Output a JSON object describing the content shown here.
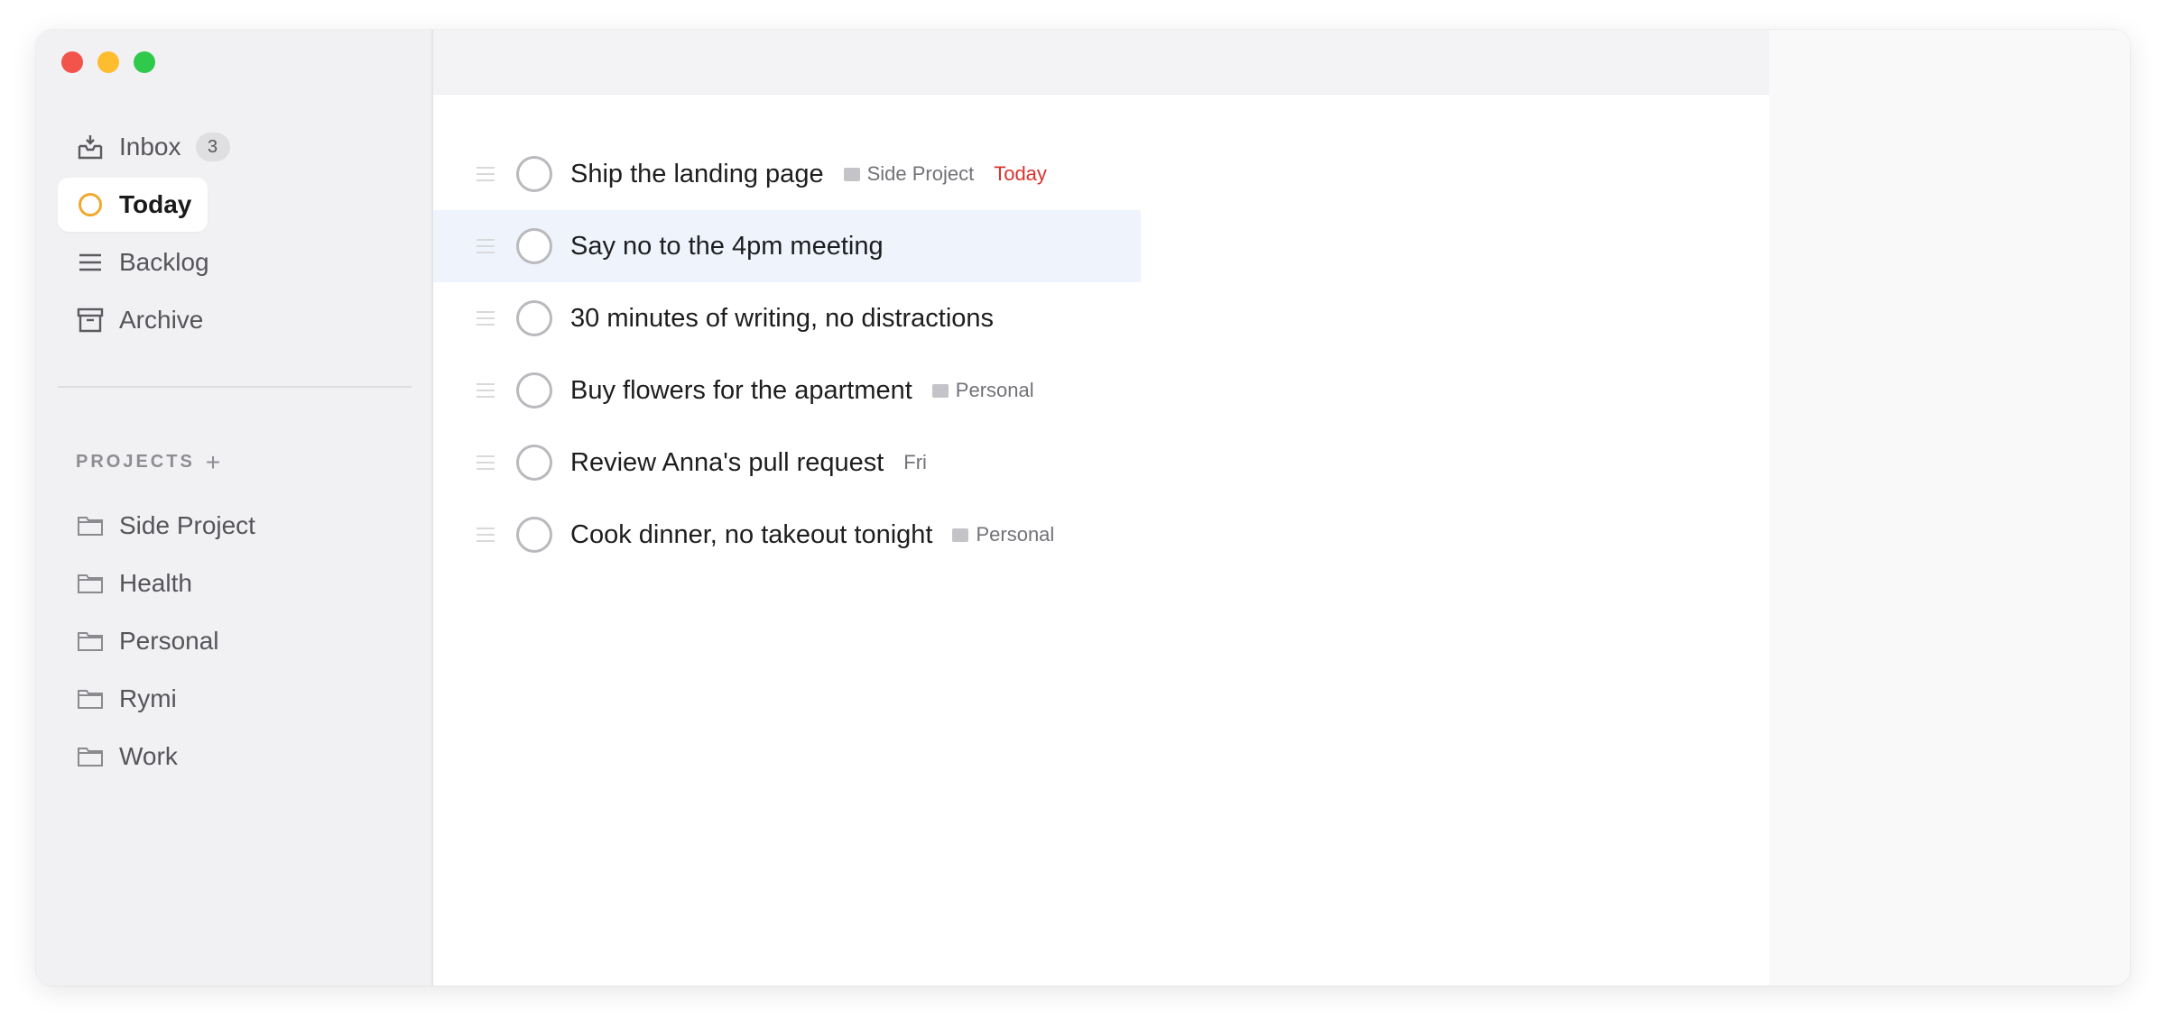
{
  "window": {
    "controls": [
      "close",
      "minimize",
      "zoom"
    ]
  },
  "colors": {
    "accent_today_ring": "#f0a92f",
    "due_today": "#d9322e",
    "row_highlight": "#eff4fc"
  },
  "sidebar": {
    "nav": [
      {
        "label": "Inbox",
        "icon": "inbox-tray-icon",
        "badge": "3",
        "active": false
      },
      {
        "label": "Today",
        "icon": "today-circle-icon",
        "active": true
      },
      {
        "label": "Backlog",
        "icon": "list-lines-icon",
        "active": false
      },
      {
        "label": "Archive",
        "icon": "archive-box-icon",
        "active": false
      }
    ],
    "projects_heading": "PROJECTS",
    "projects_add": "+",
    "projects": [
      {
        "label": "Side Project",
        "icon": "folder-icon"
      },
      {
        "label": "Health",
        "icon": "folder-icon"
      },
      {
        "label": "Personal",
        "icon": "folder-icon"
      },
      {
        "label": "Rymi",
        "icon": "folder-icon"
      },
      {
        "label": "Work",
        "icon": "folder-icon"
      }
    ]
  },
  "tasks": [
    {
      "title": "Ship the landing page",
      "tag": "Side Project",
      "due": "Today",
      "highlight": false
    },
    {
      "title": "Say no to the 4pm meeting",
      "tag": "",
      "due": "",
      "highlight": true
    },
    {
      "title": "30 minutes of writing, no distractions",
      "tag": "",
      "due": "",
      "highlight": false
    },
    {
      "title": "Buy flowers for the apartment",
      "tag": "Personal",
      "due": "",
      "highlight": false
    },
    {
      "title": "Review Anna's pull request",
      "tag": "",
      "due": "Fri",
      "highlight": false
    },
    {
      "title": "Cook dinner, no takeout tonight",
      "tag": "Personal",
      "due": "",
      "highlight": false
    }
  ]
}
